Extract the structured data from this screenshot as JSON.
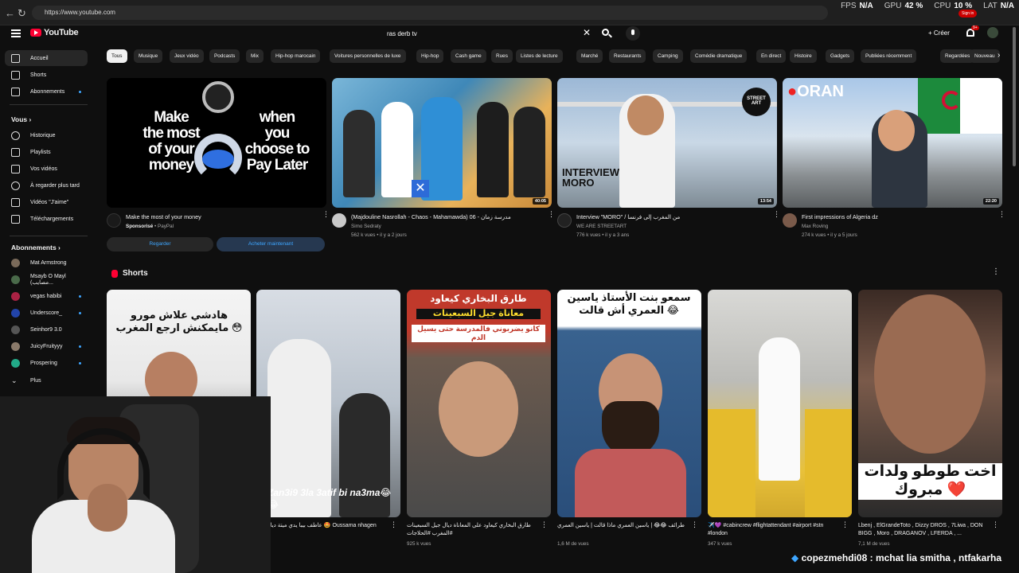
{
  "browser": {
    "url": "https://www.youtube.com",
    "stats": [
      {
        "key": "FPS",
        "val": "N/A"
      },
      {
        "key": "GPU",
        "val": "42 %"
      },
      {
        "key": "CPU",
        "val": "10 %"
      },
      {
        "key": "LAT",
        "val": "N/A"
      }
    ],
    "signin_label": "Sign in"
  },
  "masthead": {
    "logo_text": "YouTube",
    "search_value": "ras derb tv",
    "create_label": "Créer",
    "notif_badge": "9+"
  },
  "sidebar": {
    "main": [
      {
        "label": "Accueil",
        "icon": "home-icon",
        "active": true
      },
      {
        "label": "Shorts",
        "icon": "shorts-icon"
      },
      {
        "label": "Abonnements",
        "icon": "subscriptions-icon",
        "dot": true
      }
    ],
    "you_header": "Vous",
    "you": [
      {
        "label": "Historique",
        "icon": "history-icon"
      },
      {
        "label": "Playlists",
        "icon": "playlists-icon"
      },
      {
        "label": "Vos vidéos",
        "icon": "your-videos-icon"
      },
      {
        "label": "À regarder plus tard",
        "icon": "watch-later-icon"
      },
      {
        "label": "Vidéos \"J'aime\"",
        "icon": "liked-icon"
      },
      {
        "label": "Téléchargements",
        "icon": "downloads-icon"
      }
    ],
    "subs_header": "Abonnements",
    "subs": [
      {
        "label": "Mat Armstrong",
        "color": "#7a6a5a"
      },
      {
        "label": "Msayb O Mayl (مصايب...",
        "color": "#4a6a4a"
      },
      {
        "label": "vegas habibi",
        "color": "#aa2244",
        "dot": true
      },
      {
        "label": "Underscore_",
        "color": "#2244aa",
        "dot": true
      },
      {
        "label": "Seinhor9 3.0",
        "color": "#555555"
      },
      {
        "label": "JuicyFruityyy",
        "color": "#8a7a6a",
        "dot": true
      },
      {
        "label": "Prospering",
        "color": "#22aa88",
        "dot": true
      }
    ],
    "more_label": "Plus"
  },
  "chips": [
    "Tous",
    "Musique",
    "Jeux vidéo",
    "Podcasts",
    "Mix",
    "Hip-hop marocain",
    "Voitures personnelles de luxe",
    "Hip-hop",
    "Cash game",
    "Rues",
    "Listes de lecture",
    "Marché",
    "Restaurants",
    "Camping",
    "Comédie dramatique",
    "En direct",
    "Histoire",
    "Gadgets",
    "Publiées récemment",
    "Regardées",
    "Nouveau"
  ],
  "videos": [
    {
      "title": "Make the most of your money",
      "channel": "Sponsorisé",
      "channel_suffix": "PayPal",
      "views": "",
      "duration": "",
      "thumb_text": [
        "Make",
        "the most",
        "of your",
        "money",
        "when",
        "you",
        "choose to",
        "Pay Later"
      ],
      "ad_watch": "Regarder",
      "ad_buy": "Acheter maintenant"
    },
    {
      "title": "(Majdouline Nasrollah - Chaos - Mahamawda) 06 - مدرسة زمان",
      "channel": "Simo Sedraty",
      "views": "562 k vues • il y a 2 jours",
      "duration": "40:05"
    },
    {
      "title": "Interview \"MORO\" / من المغرب إلى فرنسا",
      "channel": "WE ARE STREETART",
      "views": "776 k vues • il y a 3 ans",
      "duration": "13:54",
      "thumb_text": [
        "INTERVIEW",
        "MORO"
      ],
      "badge": "STREET ART"
    },
    {
      "title": "First impressions of Algeria dz",
      "channel": "Max Roving",
      "views": "274 k vues • il y a 5 jours",
      "duration": "22:20",
      "thumb_text": [
        "ORAN"
      ]
    }
  ],
  "shorts": {
    "header": "Shorts",
    "items": [
      {
        "title": "",
        "views": "",
        "caption": "هادشي علاش مورو مايمكنش ارجع المغرب 😳"
      },
      {
        "title": "عاطف بيبا يدي ميتة ديال كرو 🤩 Oussama nhagen",
        "views": "vues",
        "caption": "Zan3i9 3la 3atif bi na3ma😂😂"
      },
      {
        "title": "طارق البخاري كيعاود على المعاناة ديال جيل السبعينات #المغرب #الحلاجات",
        "views": "925 k vues",
        "caption_top": "طارق البخاري كيعاود",
        "caption_mid": "معاناة جيل السبعينات",
        "caption_bot": "كانو يضربوني فالمدرسة حتى يسيل الدم"
      },
      {
        "title": "طرائف 😂😂 | ياسين العمري ماذا قالت | ياسين العمري",
        "views": "1,6 M de vues",
        "caption": "سمعو بنت الأستاذ ياسين العمري أش قالت 😂"
      },
      {
        "title": "✈️💜 #cabincrew #flightattendant #airport #stn #london",
        "views": "347 k vues",
        "caption": ""
      },
      {
        "title": "Lbenj , ElGrandeToto , Dizzy DROS , 7Liwa , DON BIGG , Moro , DRAGANOV , LFERDA , ...",
        "views": "7,1 M de vues",
        "caption": "اخت طوطو ولدات مبروك ❤️"
      }
    ]
  },
  "chat": {
    "user": "copezmehdi08",
    "message": "mchat lia smitha , ntfakarha"
  }
}
